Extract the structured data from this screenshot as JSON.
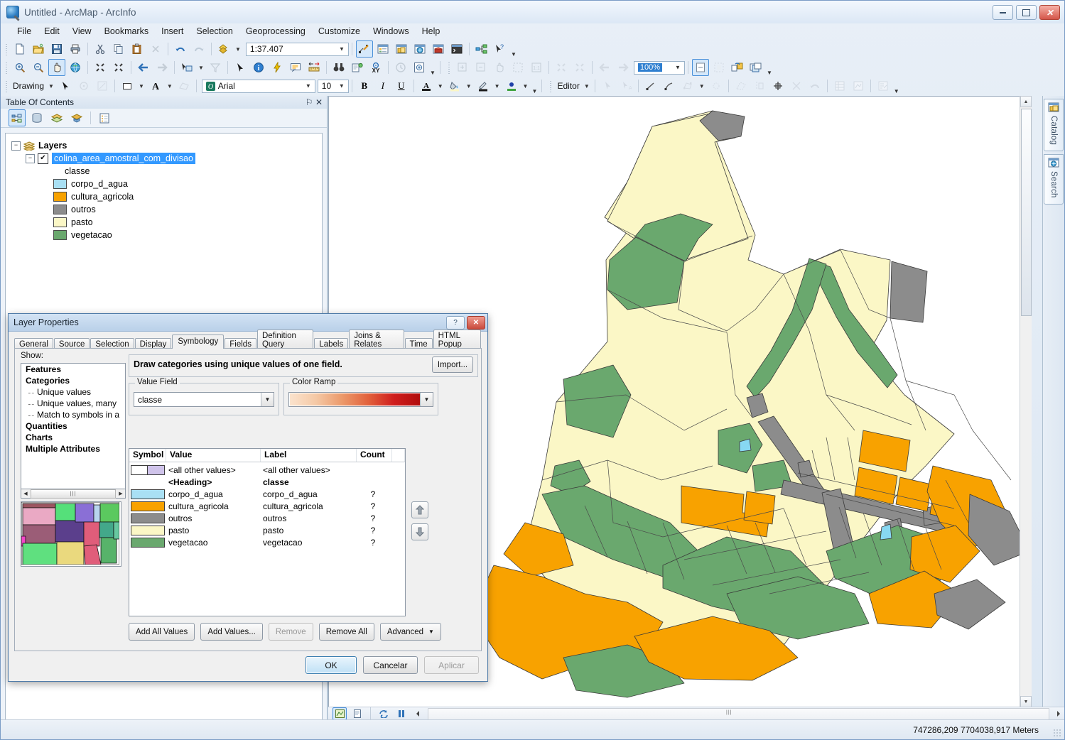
{
  "window": {
    "title": "Untitled - ArcMap - ArcInfo",
    "minimize": "—",
    "maximize": "□",
    "close": "✕"
  },
  "menu": [
    "File",
    "Edit",
    "View",
    "Bookmarks",
    "Insert",
    "Selection",
    "Geoprocessing",
    "Customize",
    "Windows",
    "Help"
  ],
  "toolbars": {
    "scale_value": "1:37.407",
    "zoom_percent": "100%",
    "font_name": "Arial",
    "font_size": "10",
    "drawing_label": "Drawing",
    "editor_label": "Editor",
    "bold": "B",
    "italic": "I",
    "underline": "U",
    "font_color": "A"
  },
  "toc": {
    "title": "Table Of Contents",
    "pin_icon": "⚐",
    "close_icon": "✕",
    "root": "Layers",
    "layer_name": "colina_area_amostral_com_divisao",
    "field_name": "classe",
    "legend": [
      {
        "label": "corpo_d_agua",
        "color": "#a9e0f4"
      },
      {
        "label": "cultura_agricola",
        "color": "#f8a200"
      },
      {
        "label": "outros",
        "color": "#8c8c8c"
      },
      {
        "label": "pasto",
        "color": "#fbf7c6"
      },
      {
        "label": "vegetacao",
        "color": "#6aa86e"
      }
    ]
  },
  "dock": {
    "catalog": "Catalog",
    "search": "Search"
  },
  "status": {
    "coordinates": "747286,209  7704038,917 Meters"
  },
  "dialog": {
    "title": "Layer Properties",
    "help_btn": "?",
    "close_btn": "✕",
    "tabs": [
      {
        "label": "General",
        "active": false
      },
      {
        "label": "Source",
        "active": false
      },
      {
        "label": "Selection",
        "active": false
      },
      {
        "label": "Display",
        "active": false
      },
      {
        "label": "Symbology",
        "active": true
      },
      {
        "label": "Fields",
        "active": false
      },
      {
        "label": "Definition Query",
        "active": false
      },
      {
        "label": "Labels",
        "active": false
      },
      {
        "label": "Joins & Relates",
        "active": false
      },
      {
        "label": "Time",
        "active": false
      },
      {
        "label": "HTML Popup",
        "active": false
      }
    ],
    "show_label": "Show:",
    "show_tree": [
      {
        "text": "Features",
        "type": "group"
      },
      {
        "text": "Categories",
        "type": "group"
      },
      {
        "text": "Unique values",
        "type": "item",
        "selected": true
      },
      {
        "text": "Unique values, many",
        "type": "item",
        "selected": false
      },
      {
        "text": "Match to symbols in a",
        "type": "item",
        "selected": false
      },
      {
        "text": "Quantities",
        "type": "group"
      },
      {
        "text": "Charts",
        "type": "group"
      },
      {
        "text": "Multiple Attributes",
        "type": "group"
      }
    ],
    "description": "Draw categories using unique values of one field.",
    "import_label": "Import...",
    "value_field_caption": "Value Field",
    "value_field_value": "classe",
    "color_ramp_caption": "Color Ramp",
    "table_headers": [
      "Symbol",
      "Value",
      "Label",
      "Count"
    ],
    "rows": [
      {
        "symbol": "#cfc3ea",
        "split": true,
        "value": "<all other values>",
        "label": "<all other values>",
        "count": "",
        "bold": false
      },
      {
        "symbol": "",
        "split": false,
        "value": "<Heading>",
        "label": "classe",
        "count": "",
        "bold": true
      },
      {
        "symbol": "#a9e0f4",
        "split": false,
        "value": "corpo_d_agua",
        "label": "corpo_d_agua",
        "count": "?",
        "bold": false
      },
      {
        "symbol": "#f8a200",
        "split": false,
        "value": "cultura_agricola",
        "label": "cultura_agricola",
        "count": "?",
        "bold": false
      },
      {
        "symbol": "#8c8c8c",
        "split": false,
        "value": "outros",
        "label": "outros",
        "count": "?",
        "bold": false
      },
      {
        "symbol": "#fbf7c6",
        "split": false,
        "value": "pasto",
        "label": "pasto",
        "count": "?",
        "bold": false
      },
      {
        "symbol": "#6aa86e",
        "split": false,
        "value": "vegetacao",
        "label": "vegetacao",
        "count": "?",
        "bold": false
      }
    ],
    "buttons": {
      "add_all": "Add All Values",
      "add_values": "Add Values...",
      "remove": "Remove",
      "remove_all": "Remove All",
      "advanced": "Advanced"
    },
    "footer": {
      "ok": "OK",
      "cancel": "Cancelar",
      "apply": "Aplicar"
    }
  },
  "colors": {
    "pasto": "#fbf7c6",
    "vegetacao": "#6aa86e",
    "cultura_agricola": "#f8a200",
    "outros": "#8c8c8c",
    "corpo_d_agua": "#87d8f2",
    "accent": "#3399ff"
  }
}
